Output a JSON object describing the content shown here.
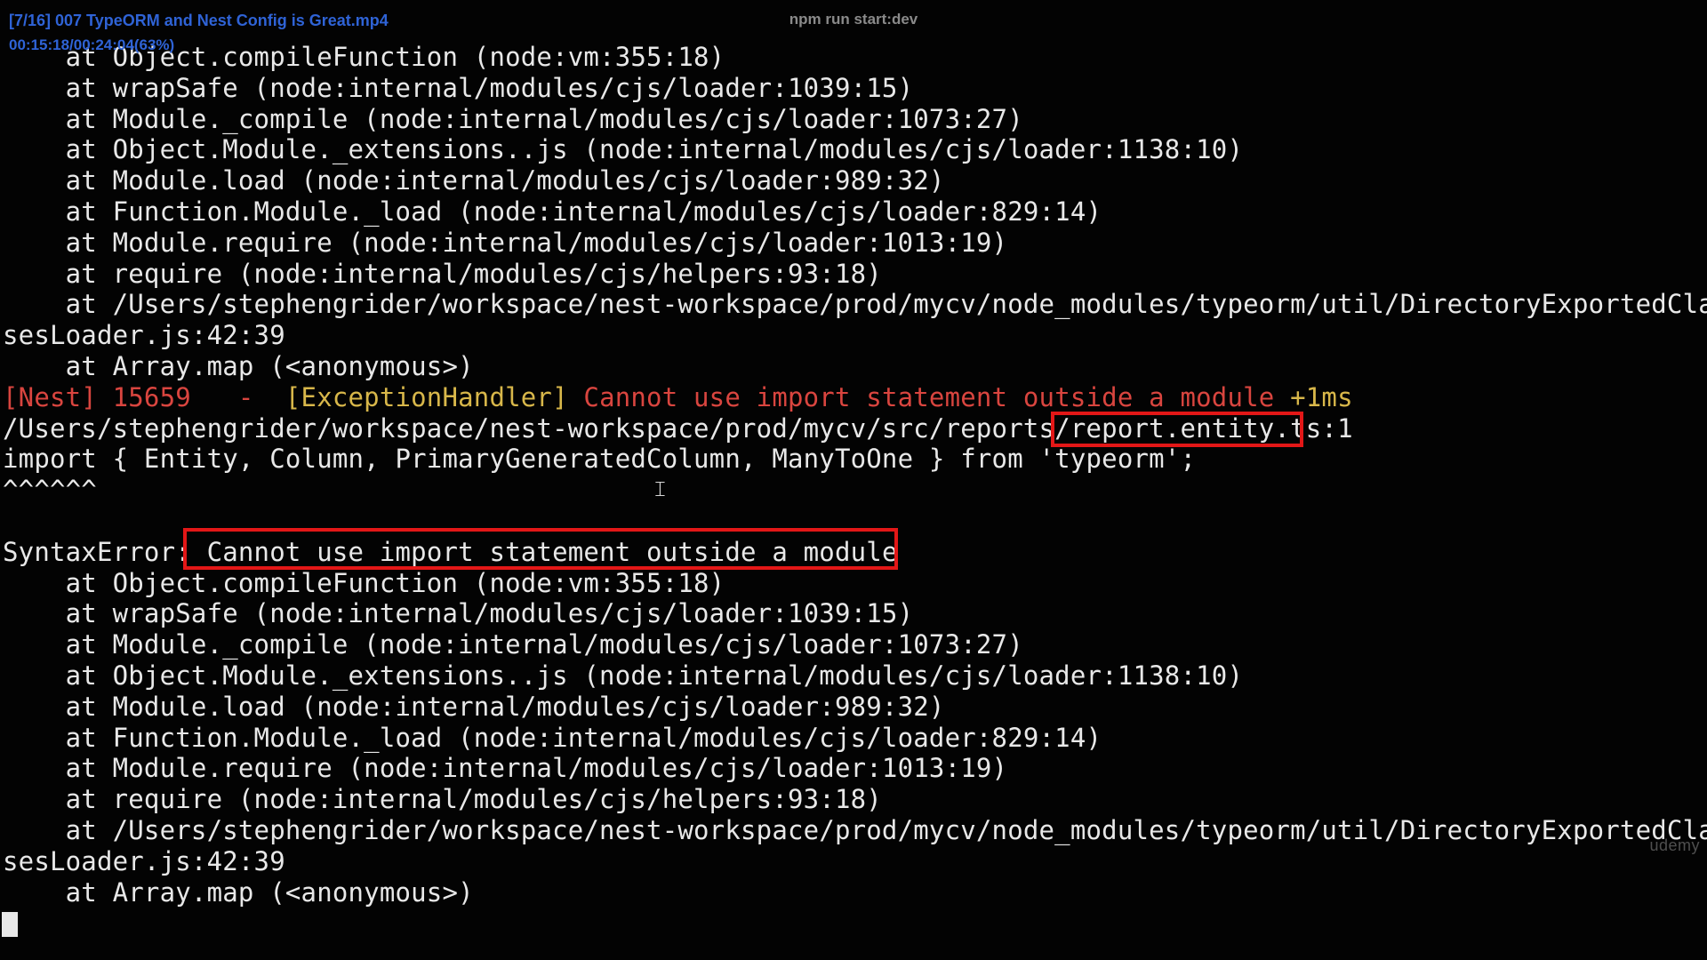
{
  "window": {
    "title": "npm run start:dev"
  },
  "video_overlay": {
    "file": "[7/16] 007 TypeORM and Nest Config is Great.mp4",
    "time": "00:15:18/00:24:04(63%)",
    "watermark": "udemy"
  },
  "terminal": {
    "lines": [
      "    at Object.compileFunction (node:vm:355:18)",
      "    at wrapSafe (node:internal/modules/cjs/loader:1039:15)",
      "    at Module._compile (node:internal/modules/cjs/loader:1073:27)",
      "    at Object.Module._extensions..js (node:internal/modules/cjs/loader:1138:10)",
      "    at Module.load (node:internal/modules/cjs/loader:989:32)",
      "    at Function.Module._load (node:internal/modules/cjs/loader:829:14)",
      "    at Module.require (node:internal/modules/cjs/loader:1013:19)",
      "    at require (node:internal/modules/cjs/helpers:93:18)",
      "    at /Users/stephengrider/workspace/nest-workspace/prod/mycv/node_modules/typeorm/util/DirectoryExportedClas",
      "sesLoader.js:42:39",
      "    at Array.map (<anonymous>)"
    ],
    "nest_error": {
      "prefix": "[Nest] 15659   -  ",
      "context": "[ExceptionHandler]",
      "message": " Cannot use import statement outside a module ",
      "timing": "+1ms"
    },
    "path_line": {
      "prefix": "/Users/stephengrider/workspace/nest-workspace/prod/mycv/src/reports/",
      "file": "report.entity.ts",
      "suffix": ":1"
    },
    "import_line": "import { Entity, Column, PrimaryGeneratedColumn, ManyToOne } from 'typeorm';",
    "caret_line": "^^^^^^",
    "syntax_error": {
      "prefix": "SyntaxError:",
      "message": " Cannot use import statement outside a module"
    },
    "stack_after": [
      "    at Object.compileFunction (node:vm:355:18)",
      "    at wrapSafe (node:internal/modules/cjs/loader:1039:15)",
      "    at Module._compile (node:internal/modules/cjs/loader:1073:27)",
      "    at Object.Module._extensions..js (node:internal/modules/cjs/loader:1138:10)",
      "    at Module.load (node:internal/modules/cjs/loader:989:32)",
      "    at Function.Module._load (node:internal/modules/cjs/loader:829:14)",
      "    at Module.require (node:internal/modules/cjs/loader:1013:19)",
      "    at require (node:internal/modules/cjs/helpers:93:18)",
      "    at /Users/stephengrider/workspace/nest-workspace/prod/mycv/node_modules/typeorm/util/DirectoryExportedClas",
      "sesLoader.js:42:39",
      "    at Array.map (<anonymous>)"
    ]
  }
}
